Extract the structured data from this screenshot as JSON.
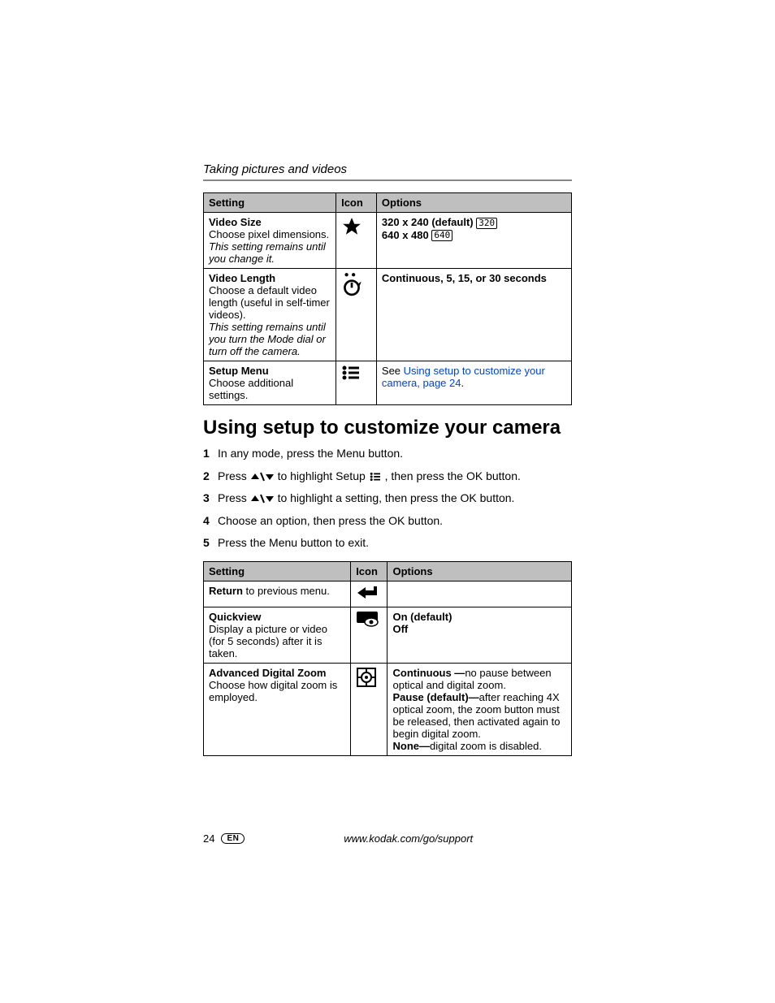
{
  "section_title": "Taking pictures and videos",
  "table1": {
    "headers": {
      "setting": "Setting",
      "icon": "Icon",
      "options": "Options"
    },
    "rows": [
      {
        "title": "Video Size",
        "desc": "Choose pixel dimensions.",
        "note": "This setting remains until you change it.",
        "icon": "star-icon",
        "opt1": "320 x 240 (default)",
        "opt1_badge": "320",
        "opt2": "640 x 480",
        "opt2_badge": "640"
      },
      {
        "title": "Video Length",
        "desc": "Choose a default video length (useful in self-timer videos).",
        "note": "This setting remains until you turn the Mode dial or turn off the camera.",
        "icon": "timer-icon",
        "opt1": "Continuous, 5, 15, or 30 seconds"
      },
      {
        "title": "Setup Menu",
        "desc": "Choose additional settings.",
        "icon": "list-icon",
        "opt_prefix": "See ",
        "opt_link": "Using setup to customize your camera, page 24",
        "opt_suffix": "."
      }
    ]
  },
  "heading": "Using setup to customize your camera",
  "steps": [
    {
      "n": "1",
      "text": "In any mode, press the Menu button."
    },
    {
      "n": "2",
      "pre": "Press ",
      "mid": " to highlight Setup ",
      "post": ", then press the OK button."
    },
    {
      "n": "3",
      "pre": "Press ",
      "post": " to highlight a setting, then press the OK button."
    },
    {
      "n": "4",
      "text": "Choose an option, then press the OK button."
    },
    {
      "n": "5",
      "text": "Press the Menu button to exit."
    }
  ],
  "table2": {
    "headers": {
      "setting": "Setting",
      "icon": "Icon",
      "options": "Options"
    },
    "rows": [
      {
        "title": "Return",
        "desc_inline": " to previous menu.",
        "icon": "return-arrow-icon"
      },
      {
        "title": "Quickview",
        "desc": "Display a picture or video (for 5 seconds) after it is taken.",
        "icon": "quickview-icon",
        "opt1": "On (default)",
        "opt2": "Off"
      },
      {
        "title": "Advanced Digital Zoom",
        "desc": "Choose how digital zoom is employed.",
        "icon": "zoom-icon",
        "opt1_bold": "Continuous —",
        "opt1_rest": "no pause between optical and digital zoom.",
        "opt2_bold": "Pause (default)—",
        "opt2_rest": "after reaching 4X optical zoom, the zoom button must be released, then activated again to begin digital zoom.",
        "opt3_bold": "None—",
        "opt3_rest": "digital zoom is disabled."
      }
    ]
  },
  "footer": {
    "page": "24",
    "lang": "EN",
    "url": "www.kodak.com/go/support"
  }
}
